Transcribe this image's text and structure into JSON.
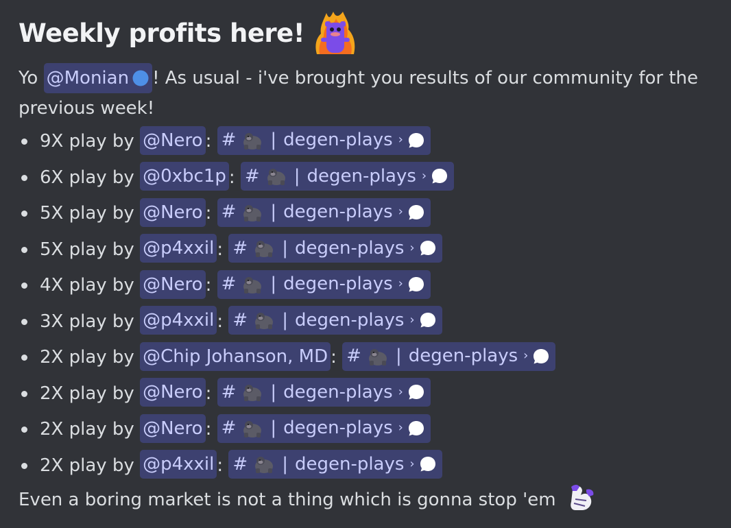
{
  "heading": "Weekly profits here!",
  "intro": {
    "prefix": "Yo ",
    "mention": "@Monian",
    "suffix": "! As usual - i've brought you results of our community for the previous week!"
  },
  "plays": [
    {
      "prefix": "9X play by ",
      "user": "@Nero",
      "channel": "degen-plays"
    },
    {
      "prefix": "6X play by ",
      "user": "@0xbc1p",
      "channel": "degen-plays"
    },
    {
      "prefix": "5X play by ",
      "user": "@Nero",
      "channel": "degen-plays"
    },
    {
      "prefix": "5X play by ",
      "user": "@p4xxil",
      "channel": "degen-plays"
    },
    {
      "prefix": "4X play by ",
      "user": "@Nero",
      "channel": "degen-plays"
    },
    {
      "prefix": "3X play by ",
      "user": "@p4xxil",
      "channel": "degen-plays"
    },
    {
      "prefix": "2X play by ",
      "user": "@Chip Johanson, MD",
      "channel": "degen-plays"
    },
    {
      "prefix": "2X play by ",
      "user": "@Nero",
      "channel": "degen-plays"
    },
    {
      "prefix": "2X play by ",
      "user": "@Nero",
      "channel": "degen-plays"
    },
    {
      "prefix": "2X play by ",
      "user": "@p4xxil",
      "channel": "degen-plays"
    }
  ],
  "channel_hash": "#",
  "channel_sep": "|",
  "channel_chevron": "›",
  "outro": "Even a boring market is not a thing which is gonna stop 'em",
  "icons": {
    "heading_emoji": "fire-blob-icon",
    "role": "blue-dot-icon",
    "channel_emoji": "gorilla-icon",
    "thread": "thread-bubble-icon",
    "outro_emoji": "flexing-arm-icon"
  },
  "colors": {
    "background": "#313338",
    "text": "#dbdee1",
    "heading": "#f2f3f5",
    "mention_text": "#c9cdfb",
    "mention_bg": "rgba(88,101,242,0.3)",
    "role_dot": "#4e8fe6"
  }
}
